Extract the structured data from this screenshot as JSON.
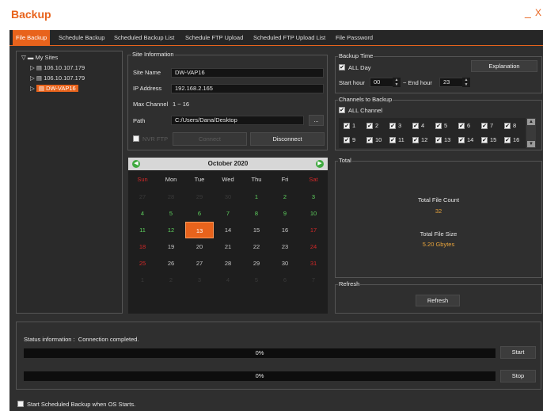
{
  "window": {
    "title": "Backup",
    "minimize": "_",
    "close": "X"
  },
  "tabs": [
    {
      "label": "File Backup",
      "active": true
    },
    {
      "label": "Schedule Backup",
      "active": false
    },
    {
      "label": "Scheduled Backup List",
      "active": false
    },
    {
      "label": "Schedule FTP Upload",
      "active": false
    },
    {
      "label": "Scheduled FTP Upload List",
      "active": false
    },
    {
      "label": "File Password",
      "active": false
    }
  ],
  "tree": {
    "root": "My Sites",
    "items": [
      "106.10.107.179",
      "106.10.107.179",
      "DW-VAP16"
    ],
    "selected_index": 2
  },
  "site_info": {
    "legend": "Site Information",
    "site_name_label": "Site Name",
    "site_name": "DW-VAP16",
    "ip_label": "IP Address",
    "ip": "192.168.2.165",
    "max_channel_label": "Max Channel",
    "max_channel": "1 ~ 16",
    "path_label": "Path",
    "path": "C:/Users/Dana/Desktop",
    "browse": "...",
    "nvr_ftp_label": "NVR FTP",
    "nvr_ftp_checked": false,
    "connect": "Connect",
    "disconnect": "Disconnect"
  },
  "calendar": {
    "month_label": "October 2020",
    "prev_icon": "arrow-left-icon",
    "next_icon": "arrow-right-icon",
    "weekdays": [
      "Sun",
      "Mon",
      "Tue",
      "Wed",
      "Thu",
      "Fri",
      "Sat"
    ],
    "days": [
      [
        "27",
        "28",
        "29",
        "30",
        "1",
        "2",
        "3"
      ],
      [
        "4",
        "5",
        "6",
        "7",
        "8",
        "9",
        "10"
      ],
      [
        "11",
        "12",
        "13",
        "14",
        "15",
        "16",
        "17"
      ],
      [
        "18",
        "19",
        "20",
        "21",
        "22",
        "23",
        "24"
      ],
      [
        "25",
        "26",
        "27",
        "28",
        "29",
        "30",
        "31"
      ],
      [
        "1",
        "2",
        "3",
        "4",
        "5",
        "6",
        "7"
      ]
    ],
    "selected_day": "13",
    "days_with_data": [
      "1",
      "2",
      "3",
      "4",
      "5",
      "6",
      "7",
      "8",
      "9",
      "10",
      "11",
      "12"
    ]
  },
  "backup_time": {
    "legend": "Backup Time",
    "all_day_label": "ALL Day",
    "all_day_checked": true,
    "explanation": "Explanation",
    "start_label": "Start hour",
    "start_value": "00",
    "end_label": "~ End hour",
    "end_value": "23"
  },
  "channels": {
    "legend": "Channels to Backup",
    "all_label": "ALL Channel",
    "all_checked": true,
    "list": [
      "1",
      "2",
      "3",
      "4",
      "5",
      "6",
      "7",
      "8",
      "9",
      "10",
      "11",
      "12",
      "13",
      "14",
      "15",
      "16"
    ]
  },
  "total": {
    "legend": "Total",
    "count_label": "Total File Count",
    "count_value": "32",
    "size_label": "Total File Size",
    "size_value": "5.20 Gbytes"
  },
  "refresh": {
    "legend": "Refresh",
    "button": "Refresh"
  },
  "status": {
    "label": "Status information :",
    "message": "Connection completed.",
    "progress1": {
      "text": "0%",
      "value": 0
    },
    "progress2": {
      "text": "0%",
      "value": 0
    },
    "start": "Start",
    "stop": "Stop"
  },
  "footer": {
    "schedule_label": "Start Scheduled Backup when OS Starts.",
    "checked": false
  },
  "colors": {
    "accent": "#e8631c",
    "count": "#e8a43c",
    "green_day": "#5ed25e",
    "red_day": "#d22828"
  }
}
